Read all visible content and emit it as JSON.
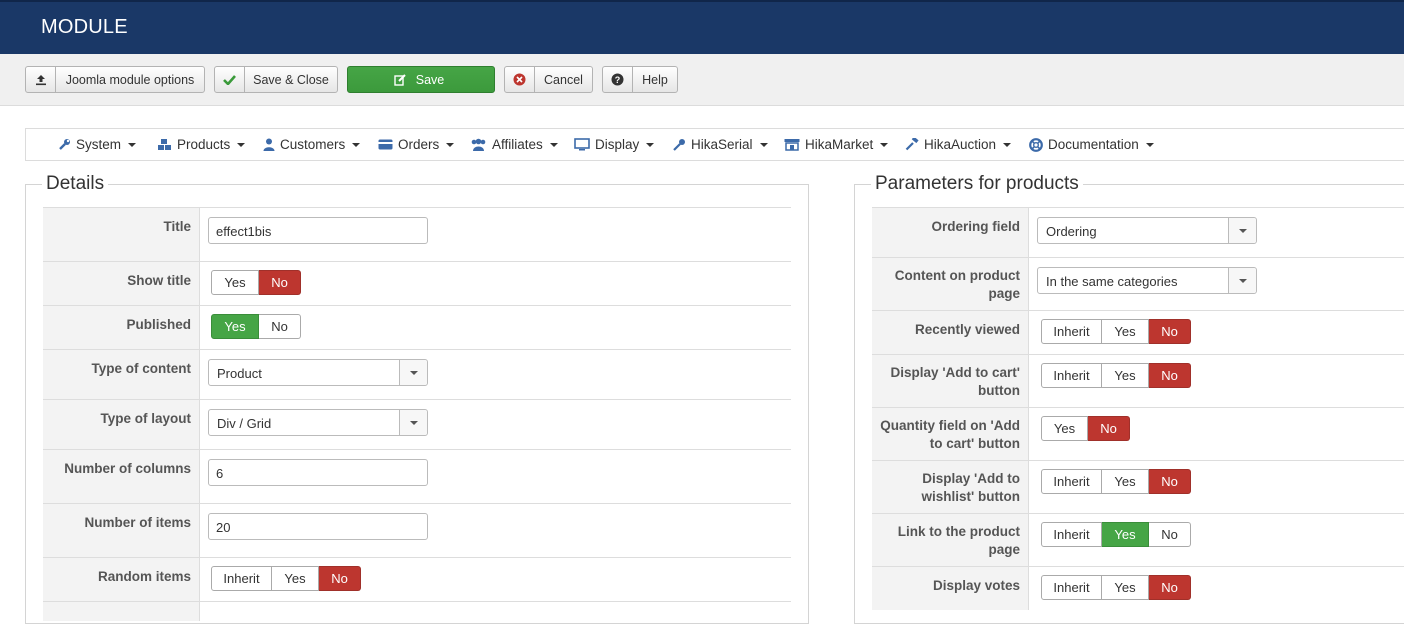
{
  "header": {
    "title": "MODULE"
  },
  "toolbar": {
    "joomla_options": "Joomla module options",
    "save_close": "Save & Close",
    "save": "Save",
    "cancel": "Cancel",
    "help": "Help"
  },
  "menu": {
    "system": "System",
    "products": "Products",
    "customers": "Customers",
    "orders": "Orders",
    "affiliates": "Affiliates",
    "display": "Display",
    "hikaserial": "HikaSerial",
    "hikamarket": "HikaMarket",
    "hikaauction": "HikaAuction",
    "documentation": "Documentation"
  },
  "details": {
    "legend": "Details",
    "title_label": "Title",
    "title_value": "effect1bis",
    "show_title_label": "Show title",
    "show_title": {
      "yes": "Yes",
      "no": "No",
      "selected": "No"
    },
    "published_label": "Published",
    "published": {
      "yes": "Yes",
      "no": "No",
      "selected": "Yes"
    },
    "type_content_label": "Type of content",
    "type_content_value": "Product",
    "type_layout_label": "Type of layout",
    "type_layout_value": "Div / Grid",
    "columns_label": "Number of columns",
    "columns_value": "6",
    "items_label": "Number of items",
    "items_value": "20",
    "random_label": "Random items",
    "random": {
      "inherit": "Inherit",
      "yes": "Yes",
      "no": "No",
      "selected": "No"
    }
  },
  "params": {
    "legend": "Parameters for products",
    "ordering_label": "Ordering field",
    "ordering_value": "Ordering",
    "content_label": "Content on product page",
    "content_value": "In the same categories",
    "recent_label": "Recently viewed",
    "add_cart_label": "Display 'Add to cart' button",
    "qty_label": "Quantity field on 'Add to cart' button",
    "wishlist_label": "Display 'Add to wishlist' button",
    "link_label": "Link to the product page",
    "votes_label": "Display votes",
    "opt": {
      "inherit": "Inherit",
      "yes": "Yes",
      "no": "No"
    },
    "recent_selected": "No",
    "add_cart_selected": "No",
    "qty_selected": "No",
    "wishlist_selected": "No",
    "link_selected": "Yes",
    "votes_selected": "No"
  },
  "colors": {
    "header": "#1a3867",
    "save": "#46a546",
    "no_active": "#bd362f",
    "yes_active": "#46a546"
  }
}
